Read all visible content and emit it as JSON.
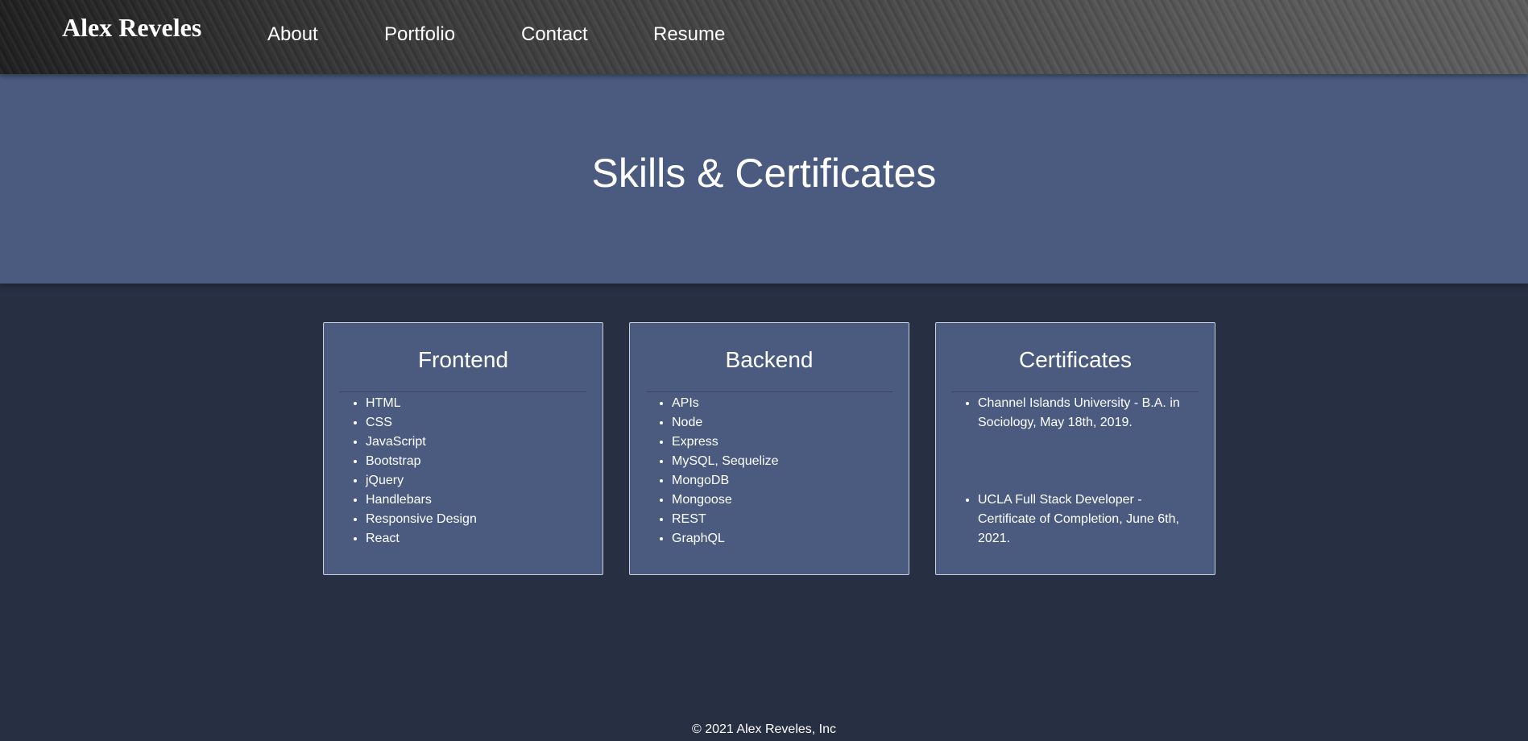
{
  "header": {
    "brand": "Alex Reveles",
    "nav": [
      "About",
      "Portfolio",
      "Contact",
      "Resume"
    ]
  },
  "hero": {
    "title": "Skills & Certificates"
  },
  "cards": {
    "frontend": {
      "title": "Frontend",
      "items": [
        "HTML",
        "CSS",
        "JavaScript",
        "Bootstrap",
        "jQuery",
        "Handlebars",
        "Responsive Design",
        "React"
      ]
    },
    "backend": {
      "title": "Backend",
      "items": [
        "APIs",
        "Node",
        "Express",
        "MySQL, Sequelize",
        "MongoDB",
        "Mongoose",
        "REST",
        "GraphQL"
      ]
    },
    "certificates": {
      "title": "Certificates",
      "items": [
        "Channel Islands University - B.A. in Sociology, May 18th, 2019.",
        "UCLA Full Stack Developer - Certificate of Completion, June 6th, 2021."
      ]
    }
  },
  "footer": {
    "text": "© 2021 Alex Reveles, Inc"
  },
  "colors": {
    "page_bg": "#272f42",
    "panel_bg": "#4b5b80",
    "text": "#ffffff"
  }
}
